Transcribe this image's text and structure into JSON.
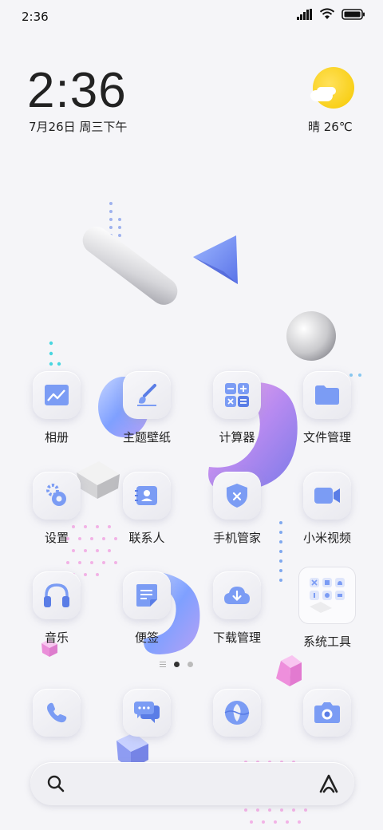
{
  "status_bar": {
    "time": "2:36",
    "icons": [
      "signal-icon",
      "wifi-icon",
      "battery-icon"
    ]
  },
  "clock_widget": {
    "time": "2:36",
    "date": "7月26日 周三下午"
  },
  "weather_widget": {
    "condition": "晴",
    "temperature": "晴 26℃",
    "icon": "sun-cloud-icon"
  },
  "apps": [
    {
      "name": "相册",
      "icon": "gallery-icon"
    },
    {
      "name": "主题壁纸",
      "icon": "theme-brush-icon"
    },
    {
      "name": "计算器",
      "icon": "calculator-icon"
    },
    {
      "name": "文件管理",
      "icon": "folder-icon"
    },
    {
      "name": "设置",
      "icon": "gear-icon"
    },
    {
      "name": "联系人",
      "icon": "contacts-icon"
    },
    {
      "name": "手机管家",
      "icon": "security-shield-icon"
    },
    {
      "name": "小米视频",
      "icon": "video-camera-icon"
    },
    {
      "name": "音乐",
      "icon": "headphones-icon"
    },
    {
      "name": "便签",
      "icon": "notes-icon"
    },
    {
      "name": "下载管理",
      "icon": "cloud-download-icon"
    },
    {
      "name": "系统工具",
      "icon": "folder-grid-icon"
    }
  ],
  "dock": [
    {
      "icon": "phone-icon"
    },
    {
      "icon": "messages-icon"
    },
    {
      "icon": "browser-icon"
    },
    {
      "icon": "camera-icon"
    }
  ],
  "pager": {
    "pages": 2,
    "active": 1
  },
  "search_bar": {
    "left_icon": "search-icon",
    "right_icon": "assistant-a-icon"
  },
  "colors": {
    "accent": "#7b9cf4",
    "accent_dark": "#5a7de6",
    "tile": "#efeff3",
    "sun": "#f6c900"
  }
}
